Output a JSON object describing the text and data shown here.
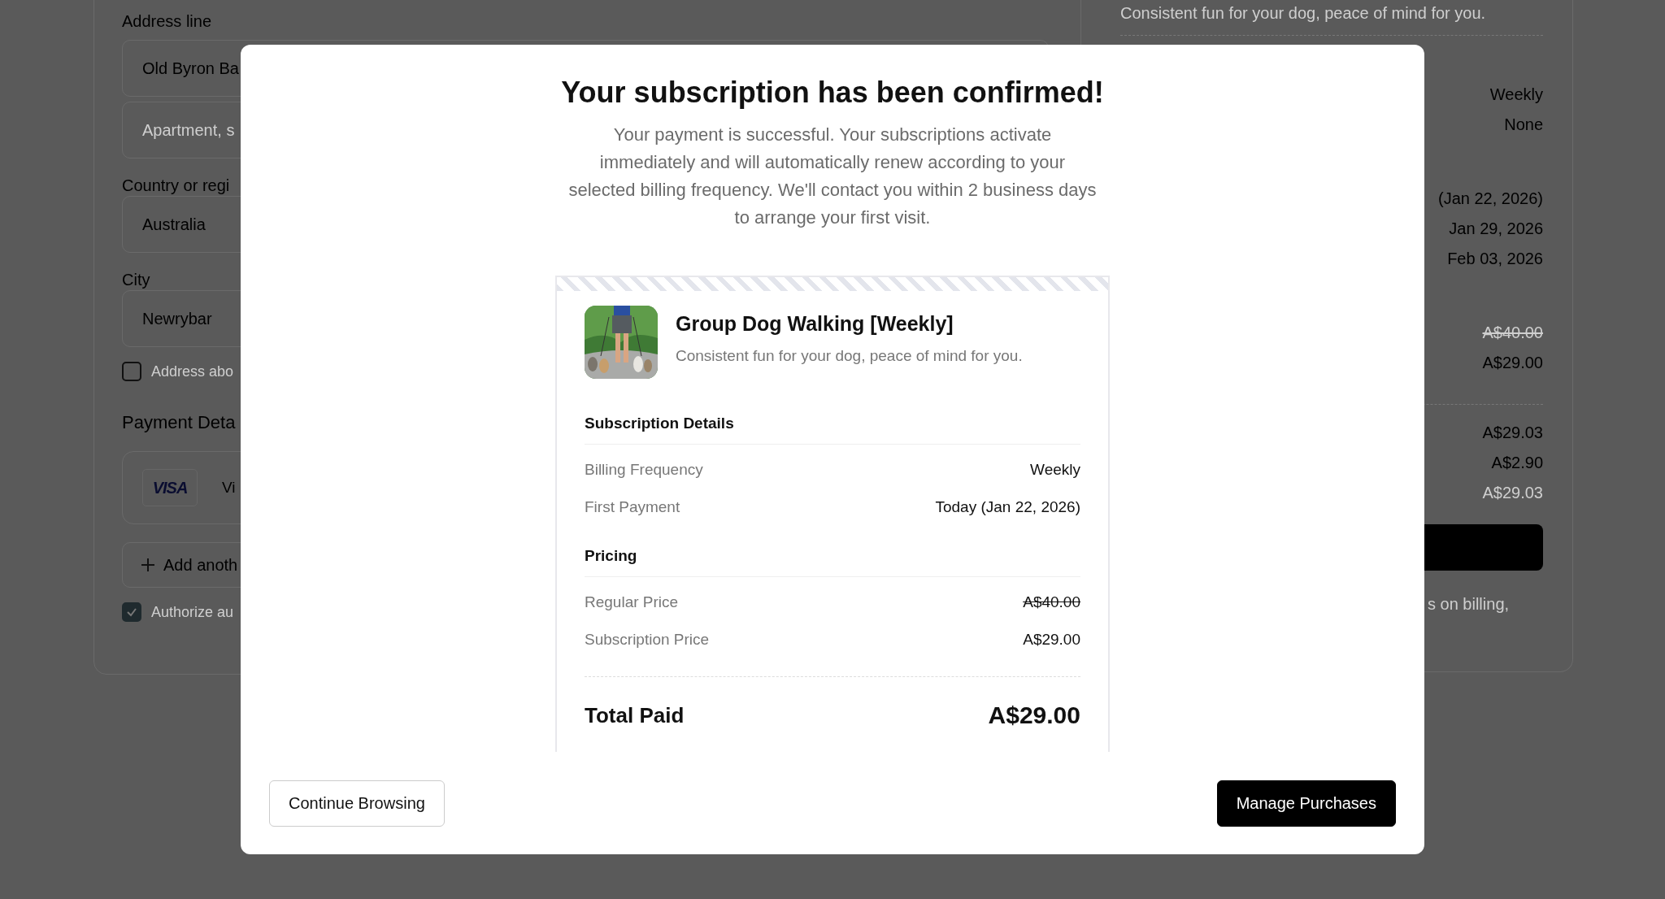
{
  "background": {
    "shipping": {
      "address_label": "Address line",
      "address_value": "Old Byron Ba",
      "apartment_placeholder": "Apartment, s",
      "country_label": "Country or regi",
      "country_value": "Australia",
      "city_label": "City",
      "city_value": "Newrybar",
      "same_address": {
        "label": "Address abo",
        "checked": false
      }
    },
    "payment": {
      "title": "Payment Deta",
      "card_brand": "VISA",
      "card_label": "Vi",
      "add_label": "Add anoth",
      "authorize": {
        "label": "Authorize au",
        "checked": true
      }
    },
    "summary": {
      "description": "Consistent fun for your dog, peace of mind for you.",
      "groups": [
        [
          {
            "value": "Weekly",
            "kind": "normal"
          },
          {
            "value": "None",
            "kind": "normal"
          }
        ],
        [
          {
            "value": "(Jan 22, 2026)",
            "kind": "normal"
          },
          {
            "value": "Jan 29, 2026",
            "kind": "normal"
          },
          {
            "value": "Feb 03, 2026",
            "kind": "normal"
          }
        ],
        [
          {
            "value": "A$40.00",
            "kind": "strike"
          },
          {
            "value": "A$29.00",
            "kind": "normal"
          }
        ]
      ],
      "totals": [
        {
          "value": "A$29.03",
          "kind": "normal"
        },
        {
          "value": "A$2.90",
          "kind": "normal"
        },
        {
          "value": "A$29.03",
          "kind": "muted"
        }
      ],
      "note": "s on billing,"
    }
  },
  "modal": {
    "title": "Your subscription has been confirmed!",
    "message": "Your payment is successful. Your subscriptions activate immediately and will automatically renew according to your selected billing frequency. We'll contact you within 2 business days to arrange your first visit.",
    "product": {
      "kind": "picture",
      "name": "Group Dog Walking [Weekly]",
      "description": "Consistent fun for your dog, peace of mind for you."
    },
    "sections": [
      {
        "heading": "Subscription Details",
        "rows": [
          {
            "label": "Billing Frequency",
            "value": "Weekly",
            "kind": "normal"
          },
          {
            "label": "First Payment",
            "value": "Today (Jan 22, 2026)",
            "kind": "normal"
          }
        ]
      },
      {
        "heading": "Pricing",
        "rows": [
          {
            "label": "Regular Price",
            "value": "A$40.00",
            "kind": "strike"
          },
          {
            "label": "Subscription Price",
            "value": "A$29.00",
            "kind": "normal"
          }
        ]
      }
    ],
    "total": {
      "label": "Total Paid",
      "value": "A$29.00"
    },
    "buttons": [
      {
        "label": "Continue Browsing",
        "kind": "secondary"
      },
      {
        "label": "Manage Purchases",
        "kind": "primary"
      }
    ]
  }
}
